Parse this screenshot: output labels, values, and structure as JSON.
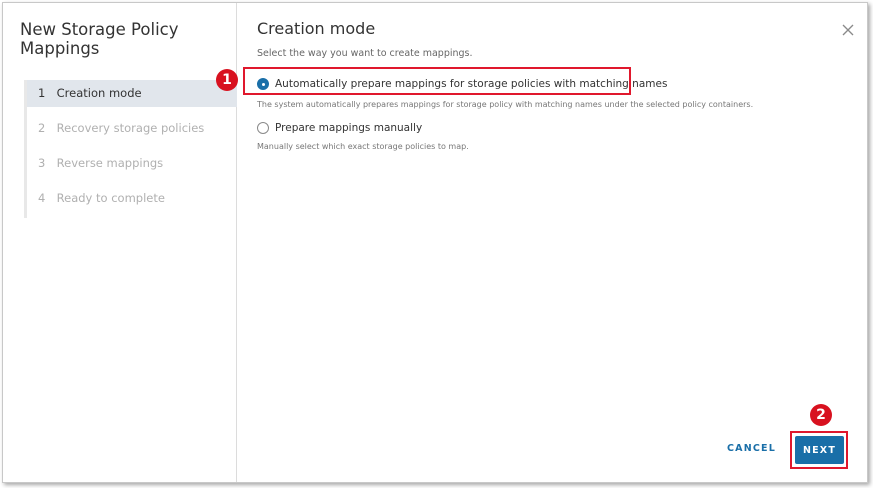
{
  "dialog": {
    "title": "New Storage Policy Mappings"
  },
  "steps": [
    {
      "num": "1",
      "label": "Creation mode",
      "active": true
    },
    {
      "num": "2",
      "label": "Recovery storage policies",
      "active": false
    },
    {
      "num": "3",
      "label": "Reverse mappings",
      "active": false
    },
    {
      "num": "4",
      "label": "Ready to complete",
      "active": false
    }
  ],
  "main": {
    "title": "Creation mode",
    "subtitle": "Select the way you want to create mappings.",
    "options": [
      {
        "label": "Automatically prepare mappings for storage policies with matching names",
        "description": "The system automatically prepares mappings for storage policy with matching names under the selected policy containers.",
        "selected": true
      },
      {
        "label": "Prepare mappings manually",
        "description": "Manually select which exact storage policies to map.",
        "selected": false
      }
    ]
  },
  "footer": {
    "cancel_label": "CANCEL",
    "next_label": "NEXT"
  },
  "annotations": {
    "badge_1": "1",
    "badge_2": "2"
  },
  "colors": {
    "accent": "#1a6fa8",
    "highlight": "#e0182d",
    "active_step_bg": "#e1e6ec"
  },
  "icons": {
    "close": "close-icon"
  }
}
